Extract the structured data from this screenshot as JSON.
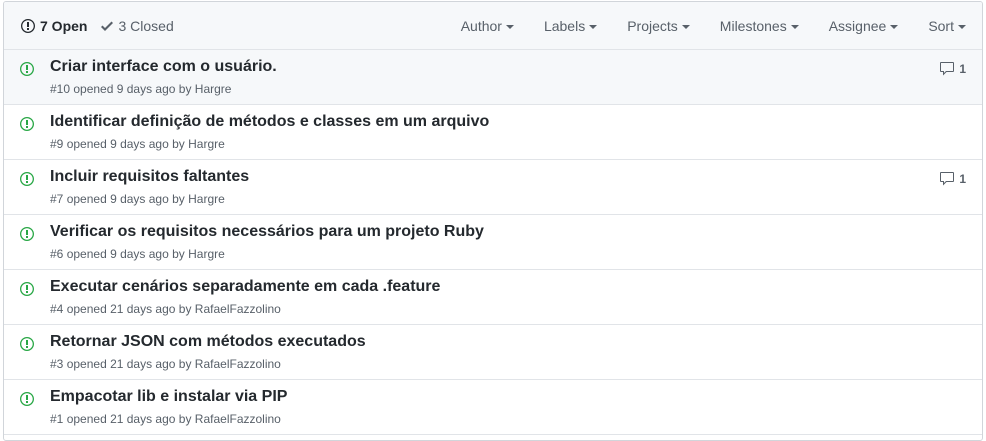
{
  "header": {
    "open_count": "7 Open",
    "closed_count": "3 Closed",
    "filters": [
      "Author",
      "Labels",
      "Projects",
      "Milestones",
      "Assignee",
      "Sort"
    ]
  },
  "issues": [
    {
      "title": "Criar interface com o usuário.",
      "number": "#10",
      "opened": " opened 9 days ago by ",
      "author": "Hargre",
      "comments": "1"
    },
    {
      "title": "Identificar definição de métodos e classes em um arquivo",
      "number": "#9",
      "opened": " opened 9 days ago by ",
      "author": "Hargre",
      "comments": ""
    },
    {
      "title": "Incluir requisitos faltantes",
      "number": "#7",
      "opened": " opened 9 days ago by ",
      "author": "Hargre",
      "comments": "1"
    },
    {
      "title": "Verificar os requisitos necessários para um projeto Ruby",
      "number": "#6",
      "opened": " opened 9 days ago by ",
      "author": "Hargre",
      "comments": ""
    },
    {
      "title": "Executar cenários separadamente em cada .feature",
      "number": "#4",
      "opened": " opened 21 days ago by ",
      "author": "RafaelFazzolino",
      "comments": ""
    },
    {
      "title": "Retornar JSON com métodos executados",
      "number": "#3",
      "opened": " opened 21 days ago by ",
      "author": "RafaelFazzolino",
      "comments": ""
    },
    {
      "title": "Empacotar lib e instalar via PIP",
      "number": "#1",
      "opened": " opened 21 days ago by ",
      "author": "RafaelFazzolino",
      "comments": ""
    }
  ],
  "icons": {
    "open_state": "issue-opened-icon",
    "closed_state": "check-icon",
    "issue": "issue-opened-icon",
    "comment": "comment-icon"
  },
  "colors": {
    "open_issue_icon": "#28a745",
    "header_bg": "#f6f8fa",
    "border": "#d1d5da",
    "muted_text": "#586069"
  }
}
